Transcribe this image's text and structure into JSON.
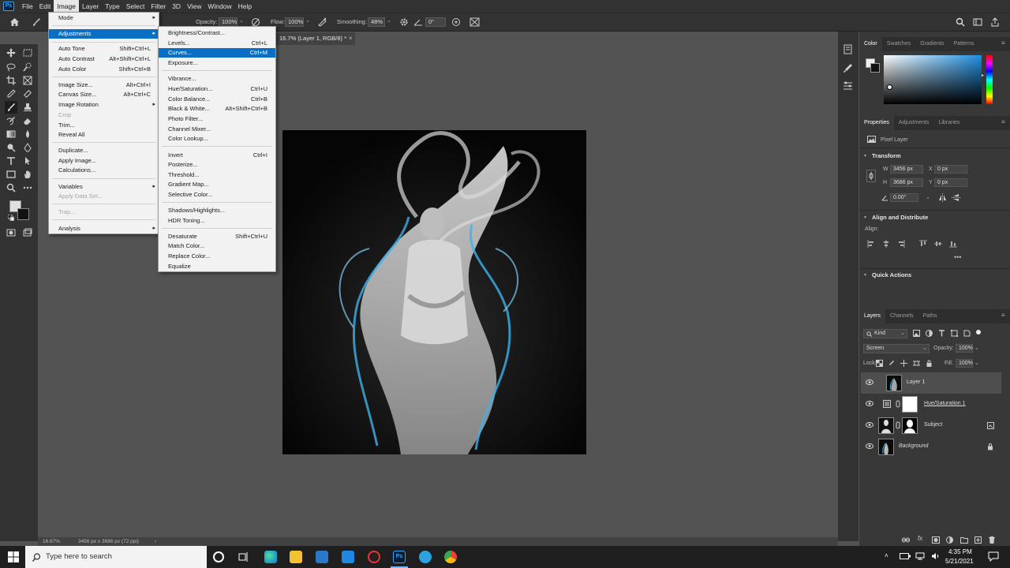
{
  "app": {
    "logo": "Ps"
  },
  "menubar": [
    "File",
    "Edit",
    "Image",
    "Layer",
    "Type",
    "Select",
    "Filter",
    "3D",
    "View",
    "Window",
    "Help"
  ],
  "options_bar": {
    "opacity_label": "Opacity:",
    "opacity": "100%",
    "flow_label": "Flow:",
    "flow": "100%",
    "smoothing_label": "Smoothing:",
    "smoothing": "48%",
    "angle": "0°"
  },
  "document_tab": "16.7% (Layer 1, RGB/8) *",
  "image_menu": {
    "items": [
      {
        "label": "Mode",
        "shortcut": "",
        "submenu": true,
        "disabled": false
      },
      {
        "label": "Adjustments",
        "shortcut": "",
        "submenu": true,
        "disabled": false,
        "highlight": true
      },
      {
        "label": "Auto Tone",
        "shortcut": "Shift+Ctrl+L",
        "disabled": false
      },
      {
        "label": "Auto Contrast",
        "shortcut": "Alt+Shift+Ctrl+L",
        "disabled": false
      },
      {
        "label": "Auto Color",
        "shortcut": "Shift+Ctrl+B",
        "disabled": false
      },
      {
        "label": "Image Size...",
        "shortcut": "Alt+Ctrl+I",
        "disabled": false
      },
      {
        "label": "Canvas Size...",
        "shortcut": "Alt+Ctrl+C",
        "disabled": false
      },
      {
        "label": "Image Rotation",
        "shortcut": "",
        "submenu": true,
        "disabled": false
      },
      {
        "label": "Crop",
        "shortcut": "",
        "disabled": true
      },
      {
        "label": "Trim...",
        "shortcut": "",
        "disabled": false
      },
      {
        "label": "Reveal All",
        "shortcut": "",
        "disabled": false
      },
      {
        "label": "Duplicate...",
        "shortcut": "",
        "disabled": false
      },
      {
        "label": "Apply Image...",
        "shortcut": "",
        "disabled": false
      },
      {
        "label": "Calculations...",
        "shortcut": "",
        "disabled": false
      },
      {
        "label": "Variables",
        "shortcut": "",
        "submenu": true,
        "disabled": false
      },
      {
        "label": "Apply Data Set...",
        "shortcut": "",
        "disabled": true
      },
      {
        "label": "Trap...",
        "shortcut": "",
        "disabled": true
      },
      {
        "label": "Analysis",
        "shortcut": "",
        "submenu": true,
        "disabled": false
      }
    ]
  },
  "adjustments_menu": {
    "items": [
      {
        "label": "Brightness/Contrast...",
        "shortcut": ""
      },
      {
        "label": "Levels...",
        "shortcut": "Ctrl+L"
      },
      {
        "label": "Curves...",
        "shortcut": "Ctrl+M",
        "highlight": true
      },
      {
        "label": "Exposure...",
        "shortcut": ""
      },
      {
        "label": "Vibrance...",
        "shortcut": ""
      },
      {
        "label": "Hue/Saturation...",
        "shortcut": "Ctrl+U"
      },
      {
        "label": "Color Balance...",
        "shortcut": "Ctrl+B"
      },
      {
        "label": "Black & White...",
        "shortcut": "Alt+Shift+Ctrl+B"
      },
      {
        "label": "Photo Filter...",
        "shortcut": ""
      },
      {
        "label": "Channel Mixer...",
        "shortcut": ""
      },
      {
        "label": "Color Lookup...",
        "shortcut": ""
      },
      {
        "label": "Invert",
        "shortcut": "Ctrl+I"
      },
      {
        "label": "Posterize...",
        "shortcut": ""
      },
      {
        "label": "Threshold...",
        "shortcut": ""
      },
      {
        "label": "Gradient Map...",
        "shortcut": ""
      },
      {
        "label": "Selective Color...",
        "shortcut": ""
      },
      {
        "label": "Shadows/Highlights...",
        "shortcut": ""
      },
      {
        "label": "HDR Toning...",
        "shortcut": ""
      },
      {
        "label": "Desaturate",
        "shortcut": "Shift+Ctrl+U"
      },
      {
        "label": "Match Color...",
        "shortcut": ""
      },
      {
        "label": "Replace Color...",
        "shortcut": ""
      },
      {
        "label": "Equalize",
        "shortcut": ""
      }
    ]
  },
  "color_panel": {
    "tabs": [
      "Color",
      "Swatches",
      "Gradients",
      "Patterns"
    ],
    "hue_color": "#1e8fe0"
  },
  "properties_panel": {
    "tabs": [
      "Properties",
      "Adjustments",
      "Libraries"
    ],
    "layer_kind": "Pixel Layer",
    "transform_title": "Transform",
    "w_label": "W",
    "w": "3456 px",
    "x_label": "X",
    "x": "0 px",
    "h_label": "H",
    "h": "3686 px",
    "y_label": "Y",
    "y": "0 px",
    "angle": "0.00°",
    "align_title": "Align and Distribute",
    "align_label": "Align:",
    "quick_actions": "Quick Actions"
  },
  "layers_panel": {
    "tabs": [
      "Layers",
      "Channels",
      "Paths"
    ],
    "kind": "Kind",
    "blend_mode": "Screen",
    "opacity_label": "Opacity:",
    "opacity": "100%",
    "lock_label": "Lock:",
    "fill_label": "Fill:",
    "fill": "100%",
    "layers": [
      {
        "name": "Layer 1",
        "selected": true
      },
      {
        "name": "Hue/Saturation 1"
      },
      {
        "name": "Subject"
      },
      {
        "name": "Background"
      }
    ]
  },
  "status_bar": {
    "zoom": "16.67%",
    "doc_info": "3456 px x 3686 px (72 ppi)"
  },
  "taskbar": {
    "search_placeholder": "Type here to search",
    "time": "4:35 PM",
    "date": "5/21/2021"
  }
}
